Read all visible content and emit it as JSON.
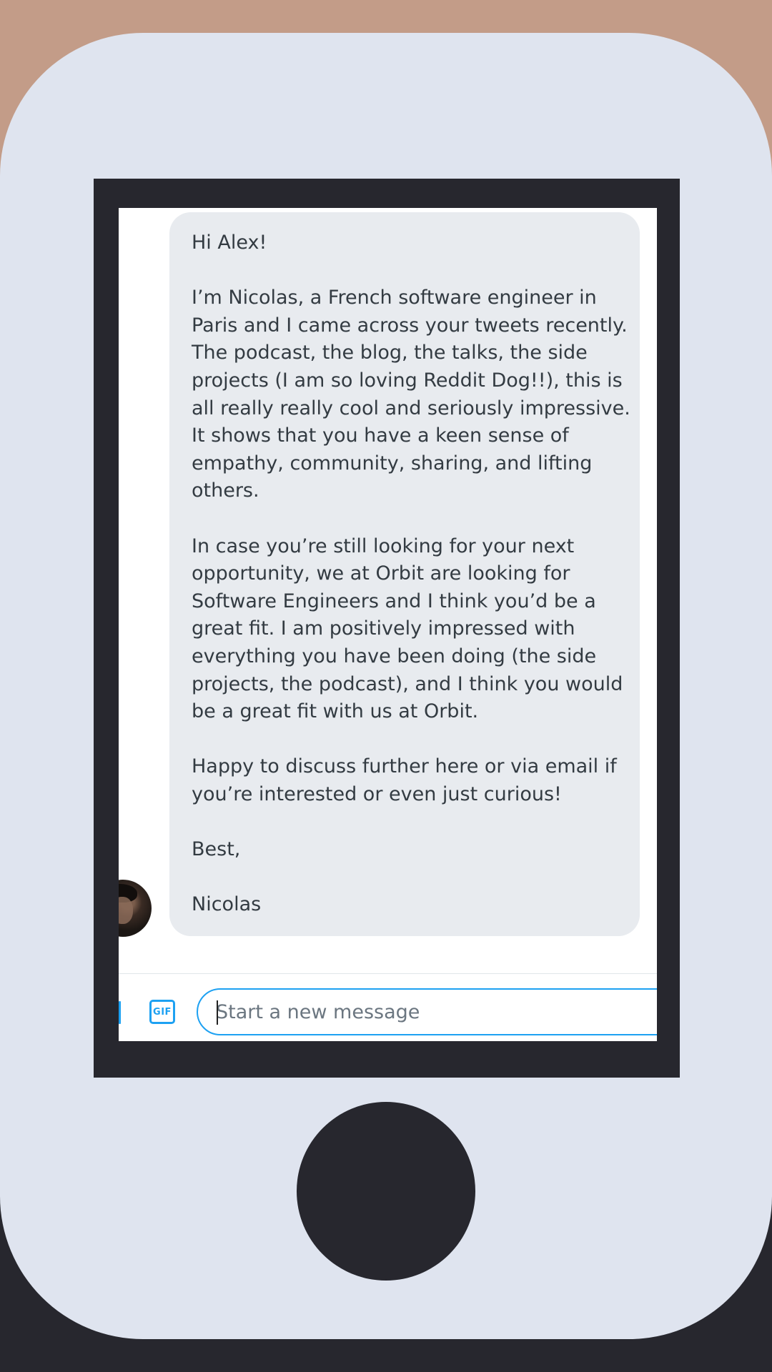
{
  "message": {
    "paragraphs": [
      [
        "Hi Alex!"
      ],
      [
        "I’m Nicolas, a French software engineer in",
        "Paris and I came across your tweets recently.",
        "The podcast, the blog, the talks, the side",
        "projects (I am so loving Reddit Dog!!), this is",
        "all really really cool and seriously impressive.",
        "It shows that you have a keen sense of",
        "empathy, community, sharing, and lifting",
        "others."
      ],
      [
        "In case you’re still looking for your next",
        "opportunity, we at Orbit are looking for",
        "Software Engineers and I think you’d be a",
        "great fit. I am positively impressed with",
        "everything you have been doing (the side",
        "projects, the podcast),  and I think you would",
        "be a great fit with us at Orbit."
      ],
      [
        "Happy to discuss further here or via email if",
        "you’re interested or even just curious!"
      ],
      [
        "Best,"
      ],
      [
        "Nicolas"
      ]
    ]
  },
  "composer": {
    "gif_label": "GIF",
    "placeholder": "Start a new message",
    "value": ""
  },
  "colors": {
    "accent": "#1da1f2",
    "bubble": "#e8ebef",
    "phone_body": "#dfe4ef",
    "bezel": "#27272e",
    "background": "#c39c88"
  },
  "icons": {
    "avatar": "avatar",
    "gif": "gif-icon"
  }
}
